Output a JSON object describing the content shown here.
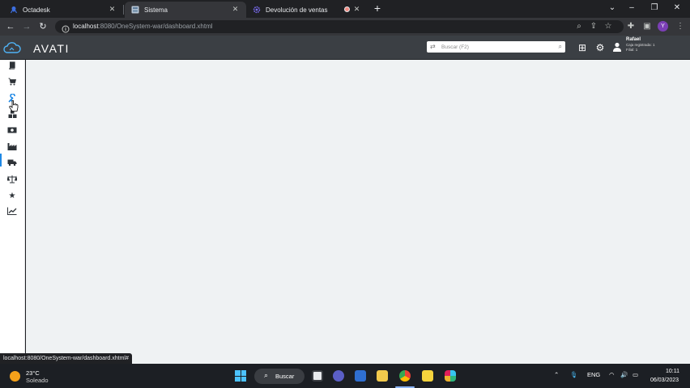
{
  "browser": {
    "tabs": [
      {
        "label": "Octadesk",
        "active": false
      },
      {
        "label": "Sistema",
        "active": true
      },
      {
        "label": "Devolución de ventas",
        "active": false
      }
    ],
    "url_host": "localhost",
    "url_path": ":8080/OneSystem-war/dashboard.xhtml",
    "profile_initial": "Y"
  },
  "app": {
    "brand": "AVATI",
    "search_placeholder": "Buscar (F2)",
    "user": {
      "name": "Rafael",
      "caja": "Caja registrada: 1",
      "filial": "Filial: 1"
    },
    "sidebar_icons": [
      "book-icon",
      "cart-icon",
      "tools-icon",
      "boxes-icon",
      "cash-icon",
      "factory-icon",
      "truck-icon",
      "scale-icon",
      "star-icon",
      "chart-line-icon"
    ]
  },
  "status_link": "localhost:8080/OneSystem-war/dashboard.xhtml#",
  "taskbar": {
    "temperature": "23°C",
    "condition": "Soleado",
    "search_label": "Buscar",
    "language": "ENG",
    "time": "10:11",
    "date": "06/03/2023"
  }
}
